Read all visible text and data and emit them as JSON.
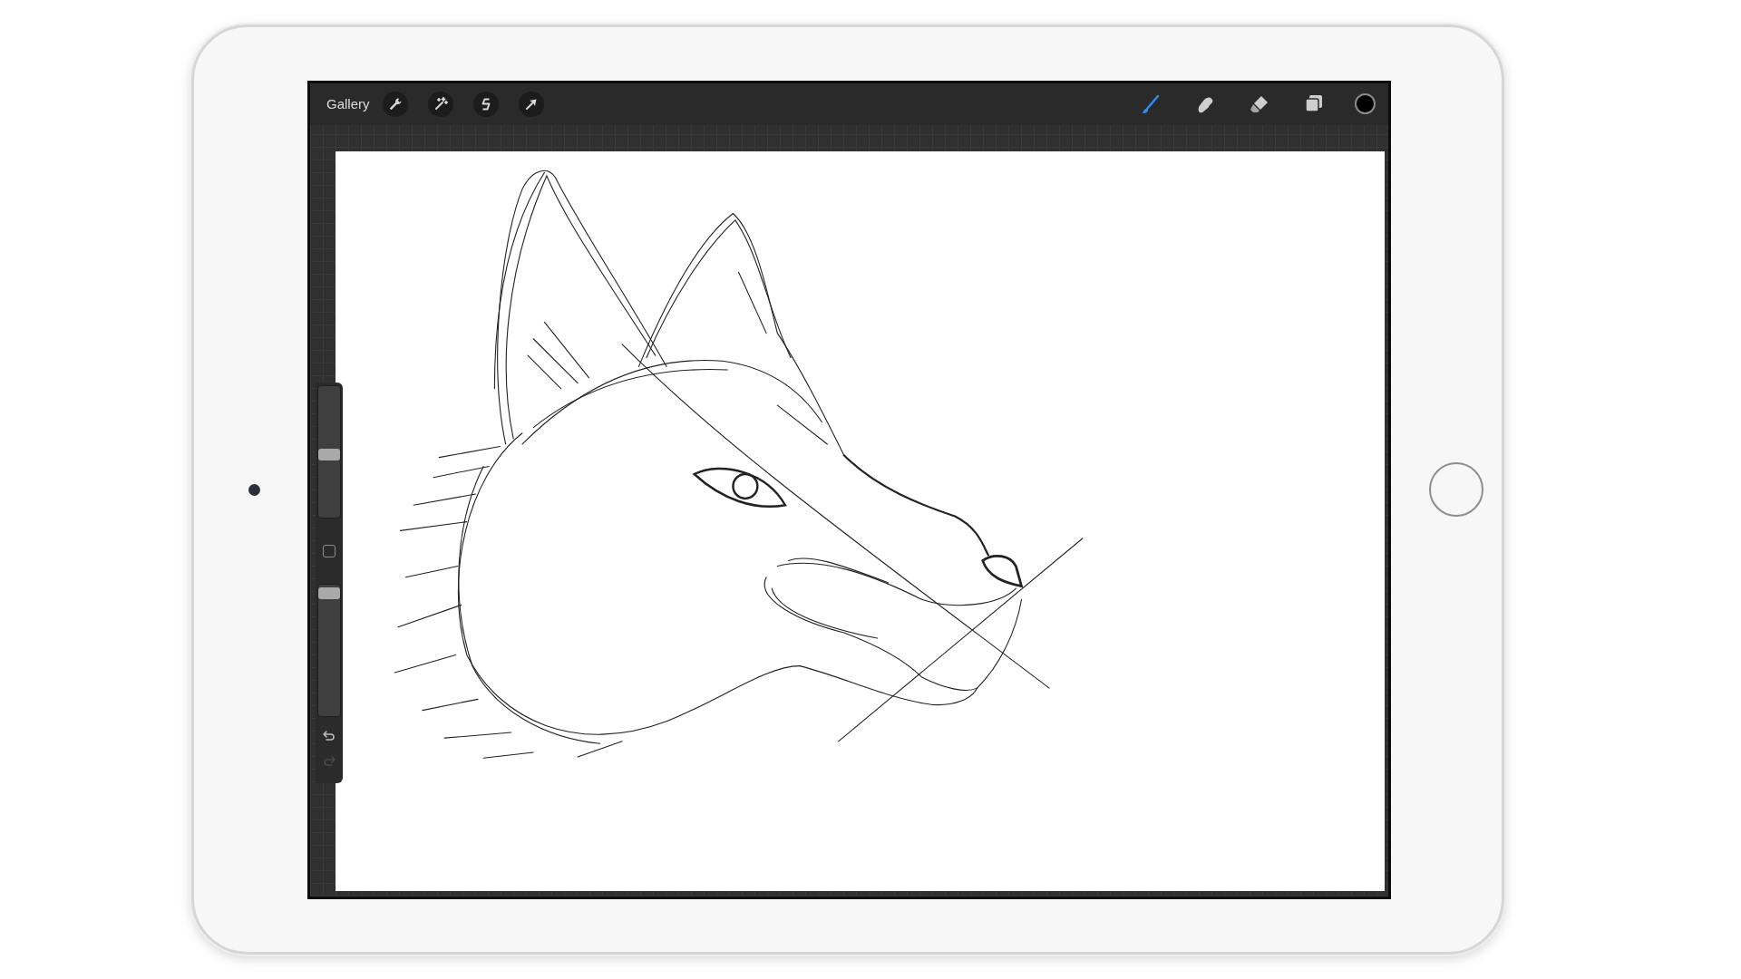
{
  "toolbar": {
    "gallery_label": "Gallery",
    "actions": [
      {
        "kind": "wrench"
      },
      {
        "kind": "wand"
      },
      {
        "kind": "selection"
      },
      {
        "kind": "transform"
      }
    ],
    "tools": [
      {
        "kind": "brush",
        "selected": true
      },
      {
        "kind": "smudge",
        "selected": false
      },
      {
        "kind": "eraser",
        "selected": false
      },
      {
        "kind": "layers",
        "selected": false
      }
    ],
    "color_swatch": {
      "color": "#000000"
    }
  },
  "sidebar": {
    "brush_size": {
      "level": 0.47
    },
    "opacity": {
      "level": 0.97
    },
    "undo": {
      "disabled": false
    },
    "redo": {
      "disabled": true
    }
  }
}
